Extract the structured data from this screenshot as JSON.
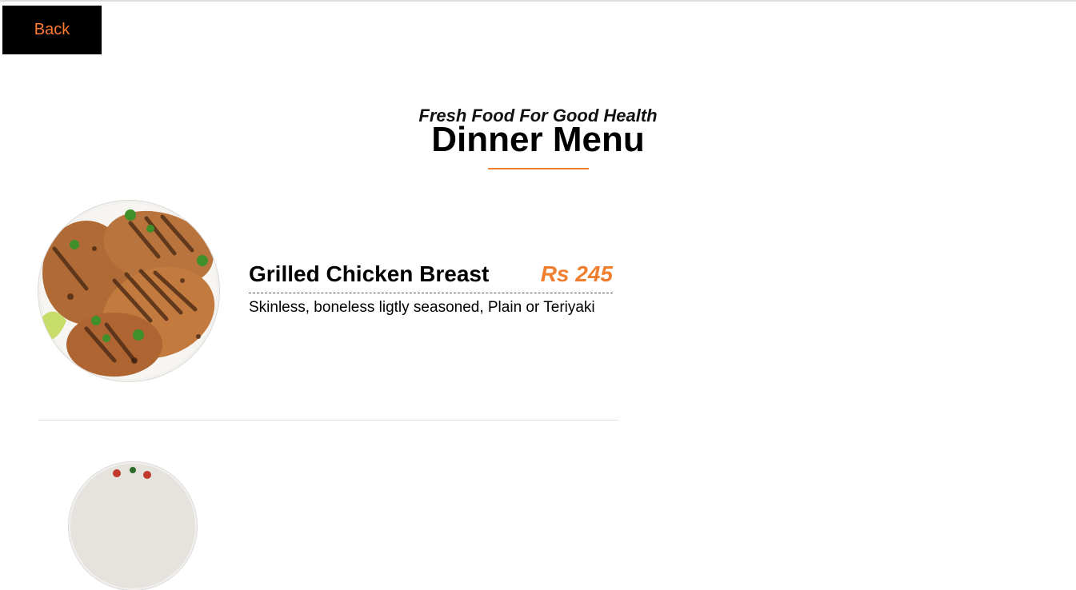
{
  "nav": {
    "back_label": "Back"
  },
  "header": {
    "tagline": "Fresh Food For Good Health",
    "title": "Dinner Menu"
  },
  "menu_items": [
    {
      "name": "Grilled Chicken Breast",
      "price": "Rs 245",
      "description": "Skinless, boneless ligtly seasoned, Plain or Teriyaki"
    }
  ],
  "colors": {
    "accent": "#ef7e2e",
    "back_text": "#ff7a33",
    "back_bg": "#000000"
  }
}
